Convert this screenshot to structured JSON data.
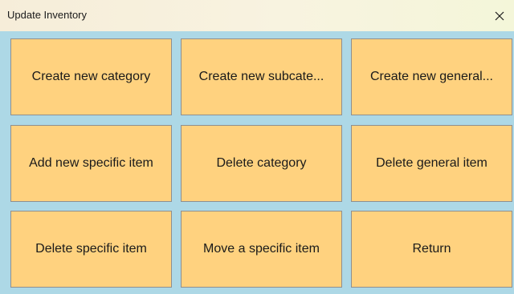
{
  "window": {
    "title": "Update Inventory",
    "close_icon": "close-icon"
  },
  "buttons": [
    {
      "label": "Create new category"
    },
    {
      "label": "Create new subcate..."
    },
    {
      "label": "Create new general..."
    },
    {
      "label": "Add new specific item"
    },
    {
      "label": "Delete category"
    },
    {
      "label": "Delete general item"
    },
    {
      "label": "Delete specific item"
    },
    {
      "label": "Move a specific item"
    },
    {
      "label": "Return"
    }
  ],
  "colors": {
    "background": "#add8e6",
    "button": "#ffd27f",
    "button_border": "#8f8f8f"
  }
}
